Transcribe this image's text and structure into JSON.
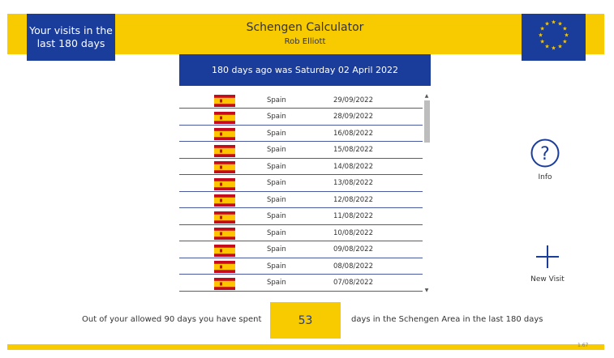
{
  "header": {
    "visits_line1": "Your visits in the",
    "visits_line2": "last 180 days",
    "title": "Schengen Calculator",
    "subtitle": "Rob Elliott",
    "eu_flag_icon": "eu-flag-icon"
  },
  "banner": {
    "days_ago": "180 days ago was Saturday 02 April 2022"
  },
  "visits": [
    {
      "country": "Spain",
      "date": "29/09/2022"
    },
    {
      "country": "Spain",
      "date": "28/09/2022"
    },
    {
      "country": "Spain",
      "date": "16/08/2022"
    },
    {
      "country": "Spain",
      "date": "15/08/2022"
    },
    {
      "country": "Spain",
      "date": "14/08/2022"
    },
    {
      "country": "Spain",
      "date": "13/08/2022"
    },
    {
      "country": "Spain",
      "date": "12/08/2022"
    },
    {
      "country": "Spain",
      "date": "11/08/2022"
    },
    {
      "country": "Spain",
      "date": "10/08/2022"
    },
    {
      "country": "Spain",
      "date": "09/08/2022"
    },
    {
      "country": "Spain",
      "date": "08/08/2022"
    },
    {
      "country": "Spain",
      "date": "07/08/2022"
    }
  ],
  "actions": {
    "info_label": "Info",
    "new_visit_label": "New Visit"
  },
  "summary": {
    "prefix": "Out of your allowed 90 days you have spent",
    "days_spent": "53",
    "suffix": "days in the Schengen Area in the last 180 days"
  },
  "footer": {
    "version": "1.67"
  },
  "colors": {
    "brand_yellow": "#f8ca00",
    "brand_blue": "#1a3c9b",
    "spain_red": "#c60b1e",
    "spain_yellow": "#ffc400"
  }
}
